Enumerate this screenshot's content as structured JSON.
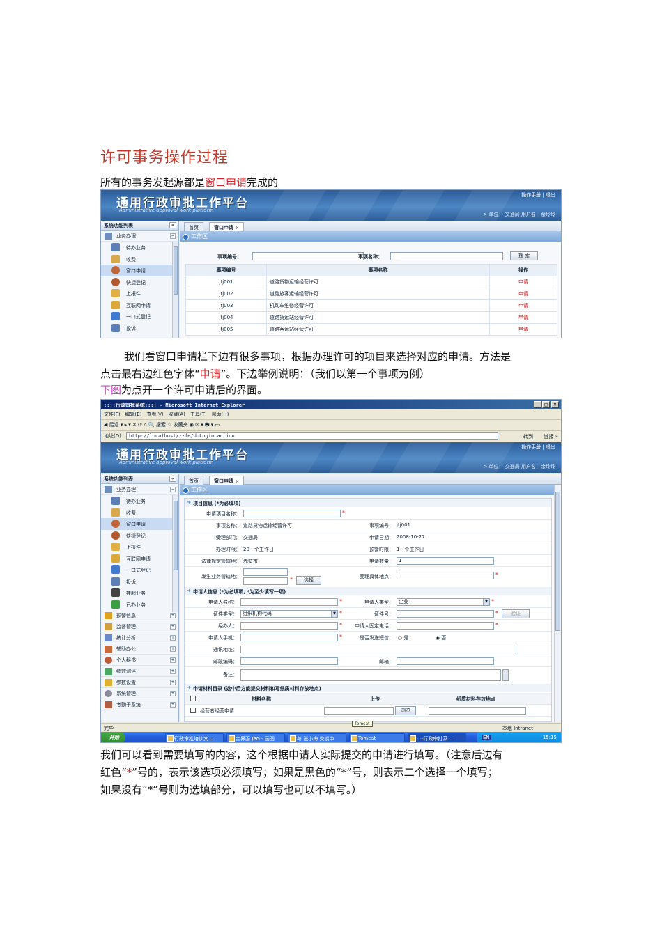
{
  "doc": {
    "title": "许可事务操作过程",
    "intro_before": "所有的事务发起源都是",
    "intro_red": "窗口申请",
    "intro_after": "完成的",
    "para2_a": "我们看窗口申请栏下边有很多事项，根据办理许可的项目来选择对应的申请。方法是",
    "para2_b_before": "点击最右边红色字体“",
    "para2_b_red": "申请",
    "para2_b_after": "”。下边举例说明：（我们以第一个事项为例）",
    "para3_pink": "下图",
    "para3_rest": "为点开一个许可申请后的界面。",
    "para4_a": "我们可以看到需要填写的内容，这个根据申请人实际提交的申请进行填写。（注意后边有",
    "para4_b_1": "红色“",
    "para4_b_star": "*",
    "para4_b_2": "”号的，表示该选项必须填写；如果是黑色的“",
    "para4_b_star2": "*",
    "para4_b_3": "”号，则表示二个选择一个填写；",
    "para4_c_1": "如果没有“",
    "para4_c_star": "*",
    "para4_c_2": "”号则为选填部分，可以填写也可以不填写。）"
  },
  "app": {
    "logo": "通用行政审批工作平台",
    "logo_sub": "Administrative approval work platform",
    "links": "操作手册 | 退出",
    "userinfo": "> 单位： 交通局 用户名：余玲玲",
    "sidebar_title": "系统功能列表",
    "sidebar_collapse": "«",
    "group_business": "业务办理",
    "items": [
      "待办业务",
      "收费",
      "窗口申请",
      "快捷登记",
      "上报件",
      "互联网申请",
      "一口式登记",
      "投诉",
      "挂起业务",
      "已办业务"
    ],
    "more_groups": [
      "预警信息",
      "监督管理",
      "统计分析",
      "辅助办公",
      "个人秘书",
      "绩效测评",
      "参数设置",
      "系统管理",
      "考勤子系统"
    ],
    "tab_home": "首页",
    "tab_window": "窗口申请",
    "tab_close": "×",
    "work_area": "工作区"
  },
  "search": {
    "code_label": "事项编号：",
    "name_label": "事项名称：",
    "search_btn": "搜 索",
    "col_code": "事项编号",
    "col_name": "事项名称",
    "col_op": "操作",
    "rows": [
      {
        "code": "jtj001",
        "name": "道路货物运输经营许可",
        "op": "申请"
      },
      {
        "code": "jtj002",
        "name": "道路旅客运输经营许可",
        "op": "申请"
      },
      {
        "code": "jtj003",
        "name": "机动车维修经营许可",
        "op": "申请"
      },
      {
        "code": "jtj004",
        "name": "道路货运站经营许可",
        "op": "申请"
      },
      {
        "code": "jtj005",
        "name": "道路客运站经营许可",
        "op": "申请"
      }
    ]
  },
  "browser": {
    "title": "::::行政审批系统:::: - Microsoft Internet Explorer",
    "menu": "文件(F)　编辑(E)　查看(V)　收藏(A)　工具(T)　帮助(H)",
    "toolbar": "◀ 后退 ▾ ▸ ▾ ✕ ⟳ ⌂ 🔍 搜索 ☆ 收藏夹 ◉ ✉ ▾ 🖶 ▾ ▭",
    "address_label": "地址(D)",
    "address": "http://localhost/zzfe/doLogin.action",
    "go": "转到",
    "links": "链接 »",
    "status_done": "完毕",
    "status_zone": "本地 Intranet",
    "tomcat_tip": "Tomcat"
  },
  "form": {
    "sec_project": "项目信息 (*为必填项)",
    "apply_name_label": "申请项目名称：",
    "item_name_label": "事项名称：",
    "item_name_val": "道路货物运输经营许可",
    "item_code_label": "事项编号：",
    "item_code_val": "jtj001",
    "dept_label": "受理部门：",
    "dept_val": "交通局",
    "date_label": "申请日期：",
    "date_val": "2008-10-27",
    "limit_label": "办理时限：",
    "limit_val": "20　个工作日",
    "warn_label": "预警时限：",
    "warn_val": "1　个工作日",
    "law_label": "法律规定管辖地：",
    "law_val": "赤壁市",
    "qty_label": "申请数量：",
    "qty_val": "1",
    "biz_area_label": "发生业务管辖地：",
    "choose_btn": "选择",
    "place_label": "受理具体地点：",
    "sec_applicant": "申请人信息 (*为必填项, *为至少填写一项)",
    "applicant_name_label": "申请人名称：",
    "applicant_type_label": "申请人类型：",
    "applicant_type_val": "企业",
    "cert_type_label": "证件类型：",
    "cert_type_val": "组织机构代码",
    "cert_no_label": "证件号：",
    "verify_btn": "验证",
    "agent_label": "经办人：",
    "phone_label": "申请人固定电话：",
    "mobile_label": "申请人手机：",
    "sms_label": "是否发送短信：",
    "sms_yes": "是",
    "sms_no": "否",
    "address_label": "通讯地址：",
    "zip_label": "邮政编码：",
    "email_label": "邮箱：",
    "remark_label": "备注：",
    "sec_materials": "申请材料目录 (选中后方能提交材料和写纸质材料存放地点)",
    "mat_name": "材料名称",
    "mat_upload": "上传",
    "mat_place": "纸质材料存放地点",
    "mat_row1": "经营者经营申请",
    "browse_btn": "浏览"
  },
  "taskbar": {
    "start": "开始",
    "tasks": [
      "行政审批培训文...",
      "主界面.JPG - 画图",
      "与 张小海 交谈中",
      "Tomcat",
      "::::行政审批系..."
    ],
    "lang": "EN",
    "clock": "15:15"
  }
}
